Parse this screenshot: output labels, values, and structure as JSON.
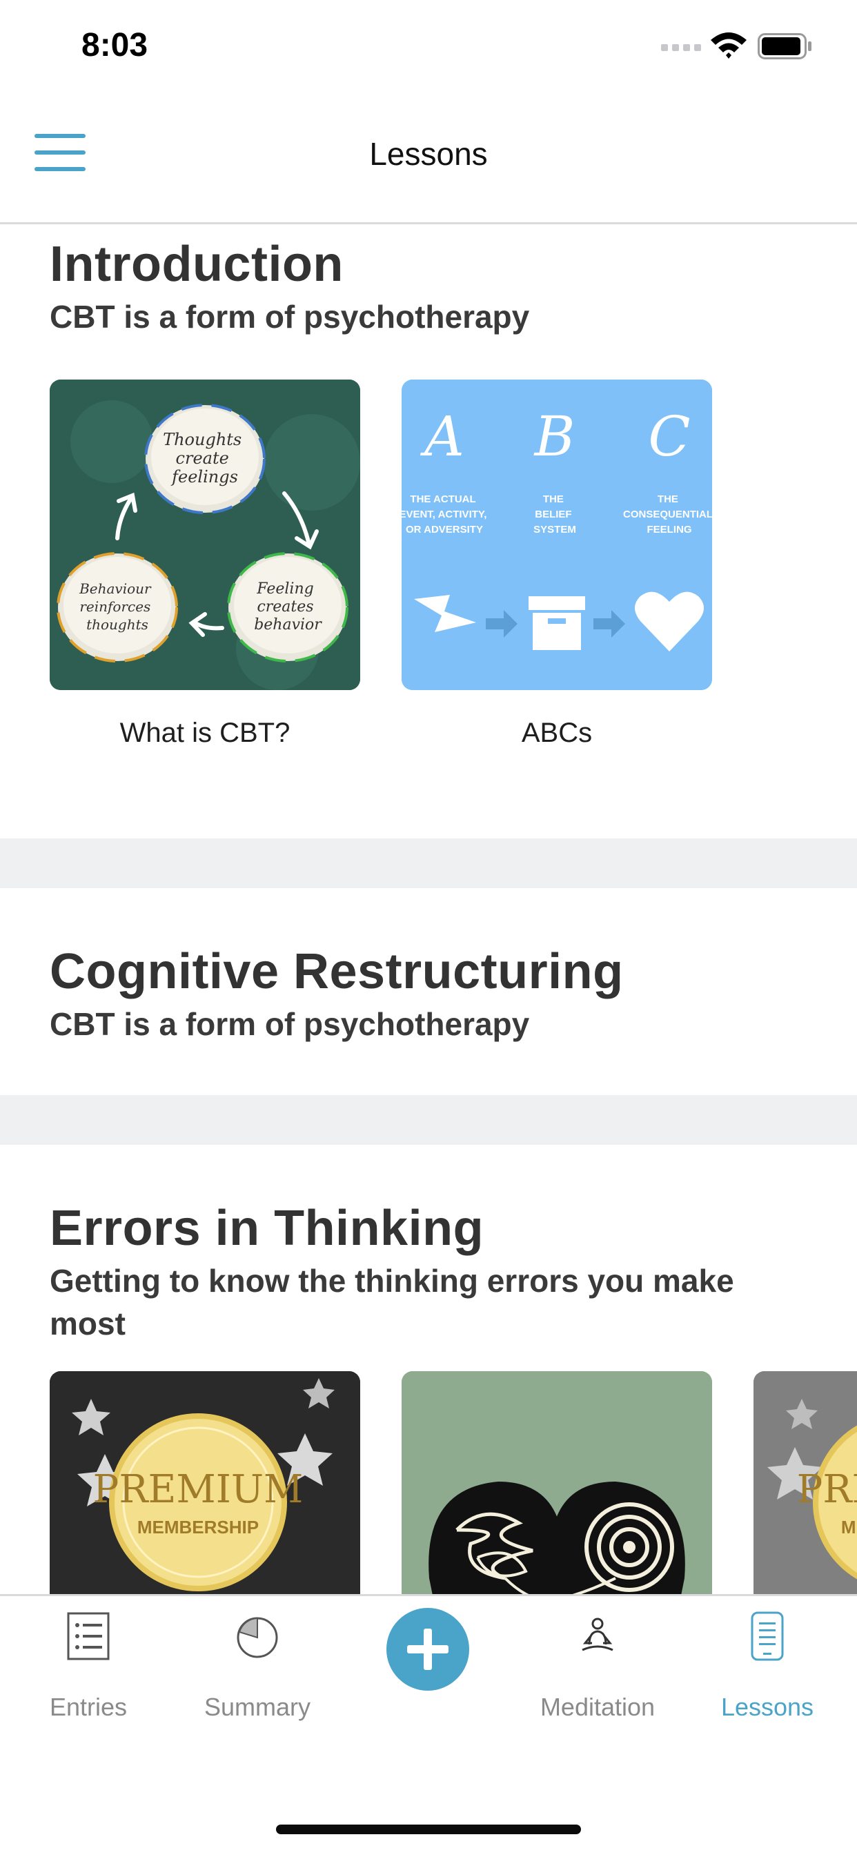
{
  "status": {
    "time": "8:03"
  },
  "header": {
    "title": "Lessons"
  },
  "sections": [
    {
      "title": "Introduction",
      "subtitle": "CBT is a form of psychotherapy",
      "cards": [
        {
          "label": "What is CBT?",
          "art_top": [
            "Thoughts",
            "create",
            "feelings"
          ],
          "art_right": [
            "Feeling",
            "creates",
            "behavior"
          ],
          "art_left": [
            "Behaviour",
            "reinforces",
            "thoughts"
          ]
        },
        {
          "label": "ABCs",
          "letters": [
            "A",
            "B",
            "C"
          ],
          "captions": [
            [
              "THE ACTUAL",
              "EVENT, ACTIVITY,",
              "OR ADVERSITY"
            ],
            [
              "THE",
              "BELIEF",
              "SYSTEM"
            ],
            [
              "THE",
              "CONSEQUENTIAL",
              "FEELING"
            ]
          ]
        }
      ]
    },
    {
      "title": "Cognitive Restructuring",
      "subtitle": "CBT is a form of psychotherapy"
    },
    {
      "title": "Errors in Thinking",
      "subtitle": "Getting to know the thinking errors you make most",
      "cards": [
        {
          "premium_line1": "PREMIUM",
          "premium_line2": "MEMBERSHIP"
        },
        {},
        {
          "premium_line1": "PREMIUM",
          "premium_line2": "MEMBERSHIP"
        }
      ]
    }
  ],
  "tabs": [
    {
      "label": "Entries",
      "icon": "list-icon"
    },
    {
      "label": "Summary",
      "icon": "pie-chart-icon"
    },
    {
      "label": "Meditation",
      "icon": "meditation-icon"
    },
    {
      "label": "Lessons",
      "icon": "phone-book-icon"
    }
  ],
  "active_tab": "Lessons",
  "colors": {
    "accent": "#4aa3c8",
    "intro_thumb_bg": "#2e5e52",
    "abc_thumb_bg": "#7ec0f7",
    "premium_thumb_bg": "#2a2a2a",
    "heads_thumb_bg": "#8fab8f",
    "separator": "#eff0f2"
  }
}
